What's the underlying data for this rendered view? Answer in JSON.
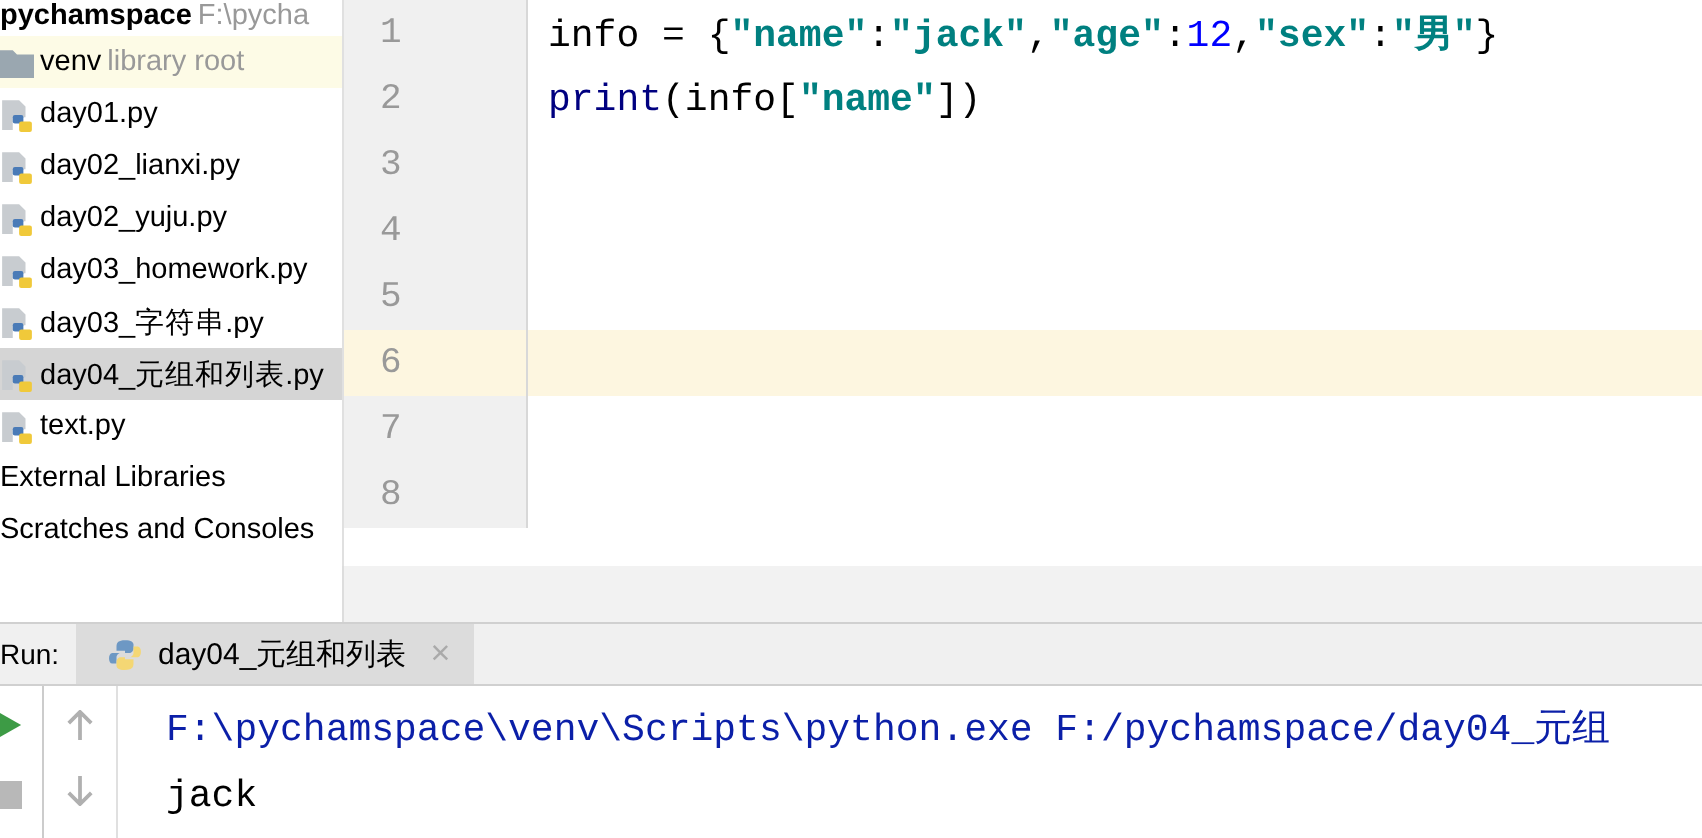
{
  "project_tree": [
    {
      "label": "pychamspace",
      "path": "F:\\pycha",
      "kind": "root",
      "selected": false,
      "children": [
        {
          "label": "venv",
          "hint": "library root",
          "kind": "folder",
          "selected": false
        },
        {
          "label": "day01.py",
          "kind": "python",
          "selected": false
        },
        {
          "label": "day02_lianxi.py",
          "kind": "python",
          "selected": false
        },
        {
          "label": "day02_yuju.py",
          "kind": "python",
          "selected": false
        },
        {
          "label": "day03_homework.py",
          "kind": "python",
          "selected": false
        },
        {
          "label": "day03_字符串.py",
          "kind": "python",
          "selected": false
        },
        {
          "label": "day04_元组和列表.py",
          "kind": "python",
          "selected": true
        },
        {
          "label": "text.py",
          "kind": "python",
          "selected": false
        }
      ]
    },
    {
      "label": "External Libraries",
      "kind": "plain",
      "selected": false
    },
    {
      "label": "Scratches and Consoles",
      "kind": "plain",
      "selected": false
    }
  ],
  "editor": {
    "lines": [
      {
        "number": "1",
        "current": false,
        "tokens": [
          {
            "text": "info = {",
            "kind": "plain"
          },
          {
            "text": "\"name\"",
            "kind": "string"
          },
          {
            "text": ":",
            "kind": "plain"
          },
          {
            "text": "\"jack\"",
            "kind": "string"
          },
          {
            "text": ",",
            "kind": "plain"
          },
          {
            "text": "\"age\"",
            "kind": "string"
          },
          {
            "text": ":",
            "kind": "plain"
          },
          {
            "text": "12",
            "kind": "number"
          },
          {
            "text": ",",
            "kind": "plain"
          },
          {
            "text": "\"sex\"",
            "kind": "string"
          },
          {
            "text": ":",
            "kind": "plain"
          },
          {
            "text": "\"男\"",
            "kind": "string"
          },
          {
            "text": "}",
            "kind": "plain"
          }
        ]
      },
      {
        "number": "2",
        "current": false,
        "tokens": [
          {
            "text": "print",
            "kind": "builtin"
          },
          {
            "text": "(info[",
            "kind": "plain"
          },
          {
            "text": "\"name\"",
            "kind": "string"
          },
          {
            "text": "])",
            "kind": "plain"
          }
        ]
      },
      {
        "number": "3",
        "current": false
      },
      {
        "number": "4",
        "current": false
      },
      {
        "number": "5",
        "current": false
      },
      {
        "number": "6",
        "current": true
      },
      {
        "number": "7",
        "current": false
      },
      {
        "number": "8",
        "current": false
      }
    ]
  },
  "run_panel": {
    "label": "Run:",
    "tabs": [
      {
        "label": "day04_元组和列表",
        "close": "×",
        "selected": true
      }
    ],
    "output": [
      {
        "text": "F:\\pychamspace\\venv\\Scripts\\python.exe F:/pychamspace/day04_元组",
        "kind": "command"
      },
      {
        "text": "jack",
        "kind": "stdout"
      }
    ]
  }
}
